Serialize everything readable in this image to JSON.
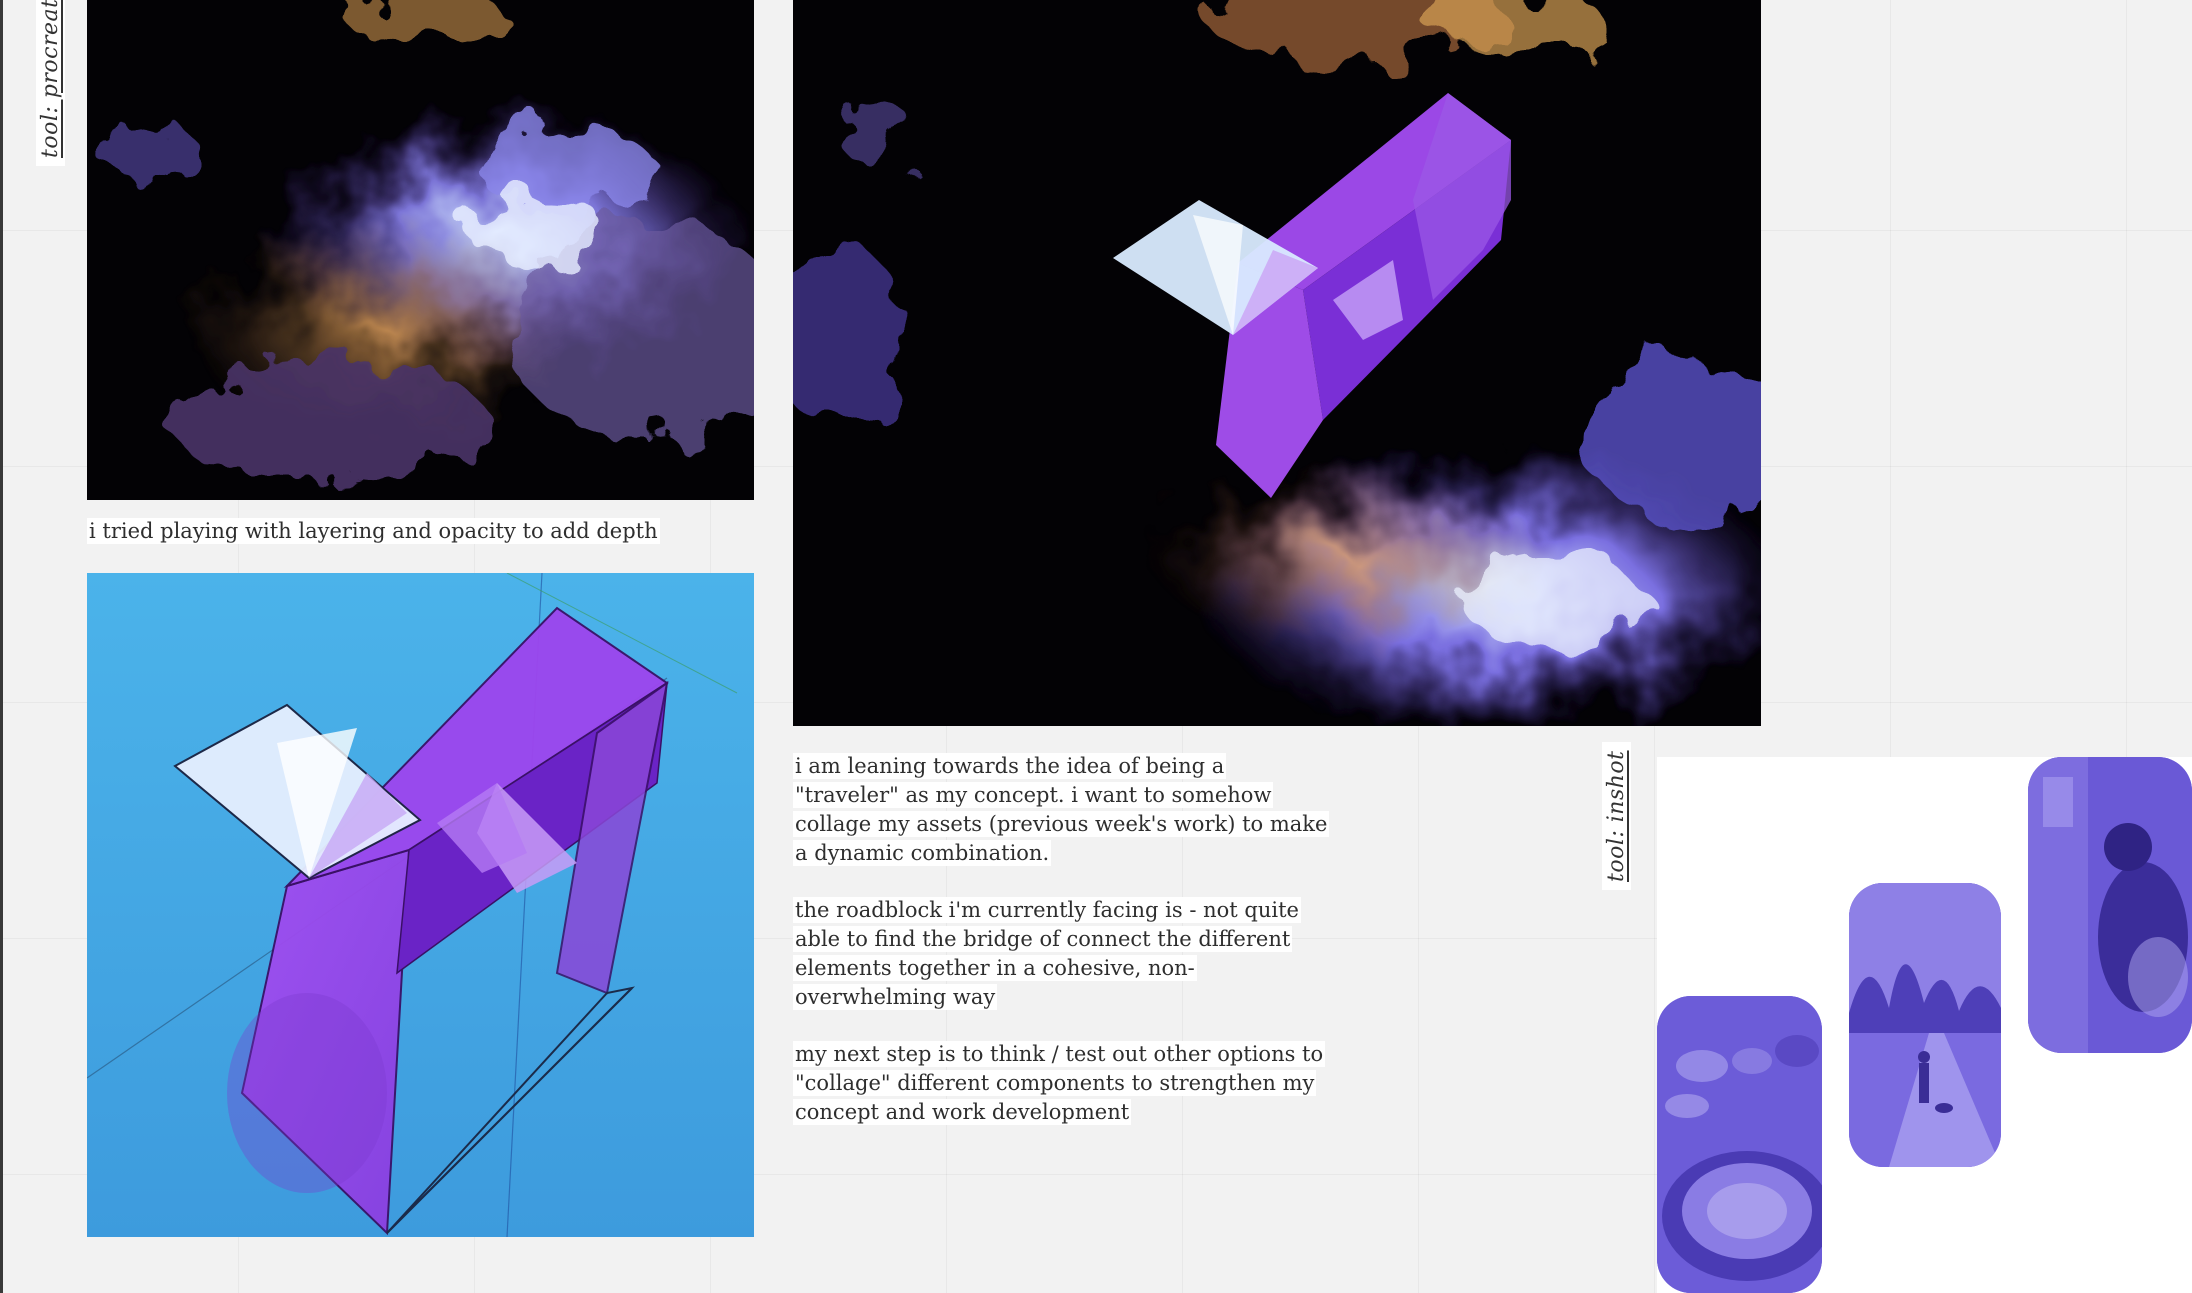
{
  "labels": {
    "procreate": "tool: procreate",
    "inshot": "tool: inshot"
  },
  "captions": {
    "layering": "i tried playing with layering and opacity to add depth",
    "notes": [
      "i am leaning towards the idea of being a \"traveler\" as my concept. i want to somehow collage my assets (previous week's work) to make a dynamic combination.",
      "the roadblock i'm currently facing is - not quite able to find the bridge of connect the different elements together in a cohesive, non-overwhelming way",
      "my next step is to think / test out other options to \"collage\" different components to strengthen my concept and work development"
    ]
  },
  "colors": {
    "canvas": "#f2f2f2",
    "purple": "#9b3cf0",
    "sky": "#43a9e3",
    "duotone": "#6a55d8"
  }
}
